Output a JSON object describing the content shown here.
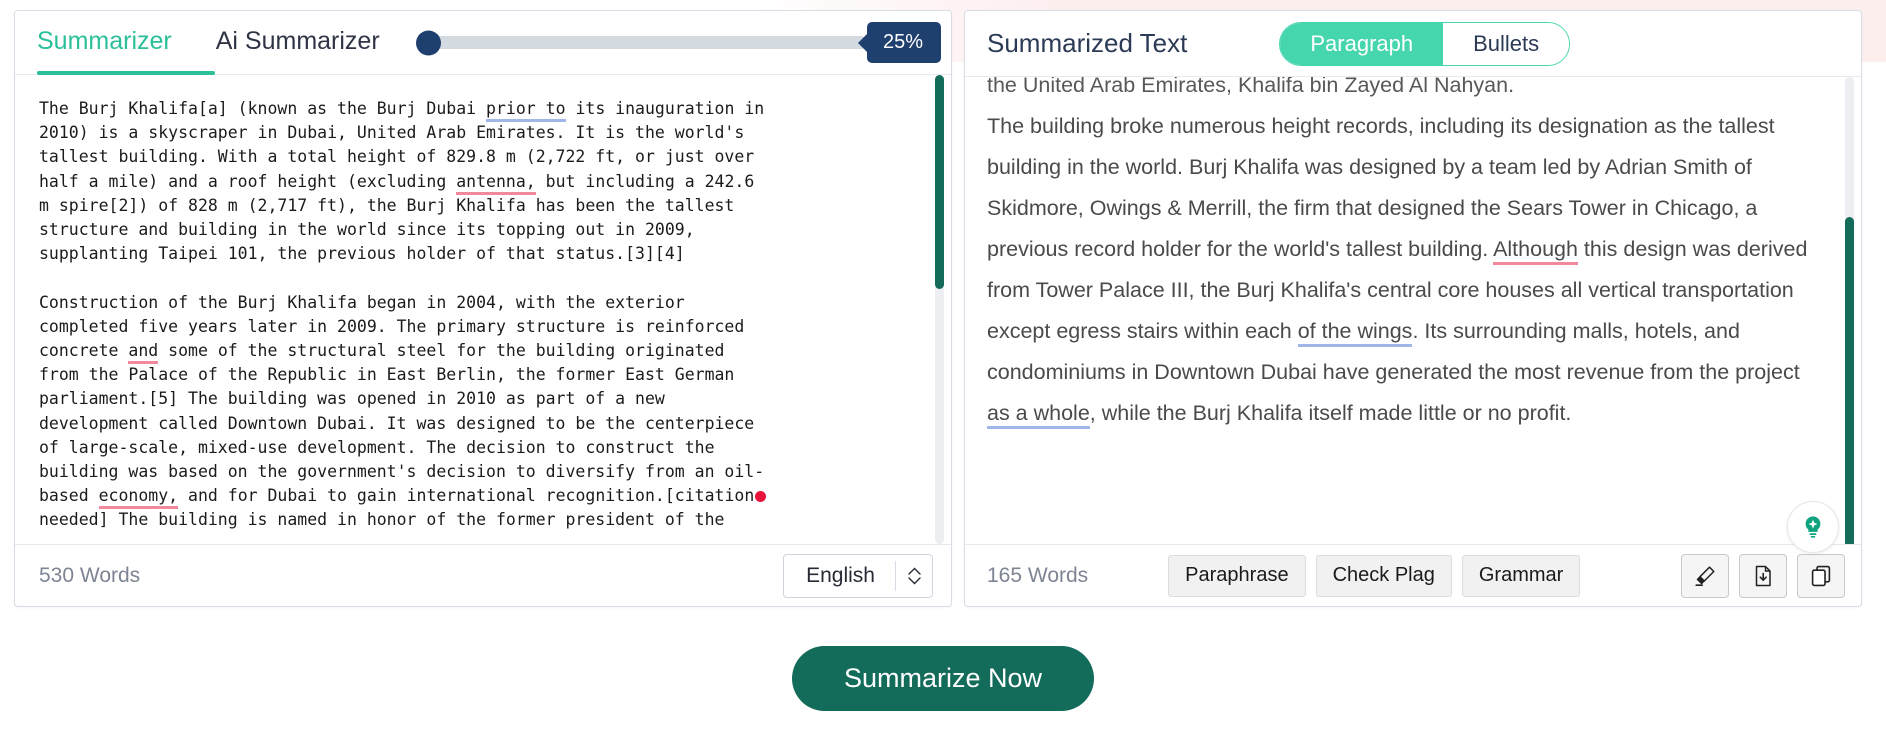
{
  "left_panel": {
    "tabs": [
      {
        "label": "Summarizer",
        "active": true
      },
      {
        "label": "Ai Summarizer",
        "active": false
      }
    ],
    "slider": {
      "value_label": "25%",
      "value": 25,
      "min": 0,
      "max": 100
    },
    "source_text": {
      "p1_a": "The Burj Khalifa[a] (known as the Burj Dubai ",
      "p1_hl_blue": "prior to",
      "p1_b": " its inauguration in\n2010) is a skyscraper in Dubai, United Arab Emirates. It is the world's\ntallest building. With a total height of 829.8 m (2,722 ft, or just over\nhalf a mile) and a roof height (excluding ",
      "p1_hl_pink": "antenna,",
      "p1_c": " but including a 242.6\nm spire[2]) of 828 m (2,717 ft), the Burj Khalifa has been the tallest\nstructure and building in the world since its topping out in 2009,\nsupplanting Taipei 101, the previous holder of that status.[3][4]",
      "p2_a": "Construction of the Burj Khalifa began in 2004, with the exterior\ncompleted five years later in 2009. The primary structure is reinforced\nconcrete ",
      "p2_hl_pink1": "and",
      "p2_b": " some of the structural steel for the building originated\nfrom the Palace of the Republic in East Berlin, the former East German\nparliament.[5] The building was opened in 2010 as part of a new\ndevelopment called Downtown Dubai. It was designed to be the centerpiece\nof large-scale, mixed-use development. The decision to construct the\nbuilding was based on the government's decision to diversify from an oil-\nbased ",
      "p2_hl_pink2": "economy,",
      "p2_c": " and for Dubai to gain international recognition.[citation",
      "p2_d": "needed] The building is named in honor of the former president of the"
    },
    "footer": {
      "word_count": "530 Words",
      "language": "English",
      "language_options": [
        "English"
      ]
    }
  },
  "right_panel": {
    "title": "Summarized Text",
    "view_modes": [
      {
        "label": "Paragraph",
        "active": true
      },
      {
        "label": "Bullets",
        "active": false
      }
    ],
    "summary_text": {
      "clipped_line": "the United Arab Emirates, Khalifa bin Zayed Al Nahyan.",
      "s1": "The building broke numerous height records, including its designation as the tallest building in the world.",
      "s2": "Burj Khalifa was designed by a team led by Adrian Smith of Skidmore, Owings & Merrill, the firm that designed the Sears Tower in Chicago, a previous record holder for the world's tallest building.",
      "s3_hl_pink": "Although",
      "s3_a": " this design was derived from Tower Palace III, the Burj Khalifa's central core houses all vertical transportation except egress stairs within each ",
      "s3_hl_blue": "of the wings",
      "s3_b": ".",
      "s4_a": "Its surrounding malls, hotels, and condominiums in Downtown Dubai have generated the most revenue from the project ",
      "s4_hl_blue": "as a whole",
      "s4_b": ", while the Burj Khalifa itself made little or no profit."
    },
    "footer": {
      "word_count": "165 Words",
      "actions": [
        "Paraphrase",
        "Check Plag",
        "Grammar"
      ],
      "icons": [
        "highlighter-icon",
        "download-document-icon",
        "copy-icon"
      ],
      "assistant_icon": "lightbulb-icon"
    }
  },
  "cta": {
    "label": "Summarize Now"
  },
  "colors": {
    "accent_teal": "#2bbf9a",
    "segment_teal": "#46d6ad",
    "cta_green": "#136b5a",
    "scrollbar_green": "#146b5a",
    "navy": "#1f3f6e",
    "underline_blue": "#9fb6e8",
    "underline_pink": "#f2889b",
    "red_dot": "#e8123b"
  }
}
